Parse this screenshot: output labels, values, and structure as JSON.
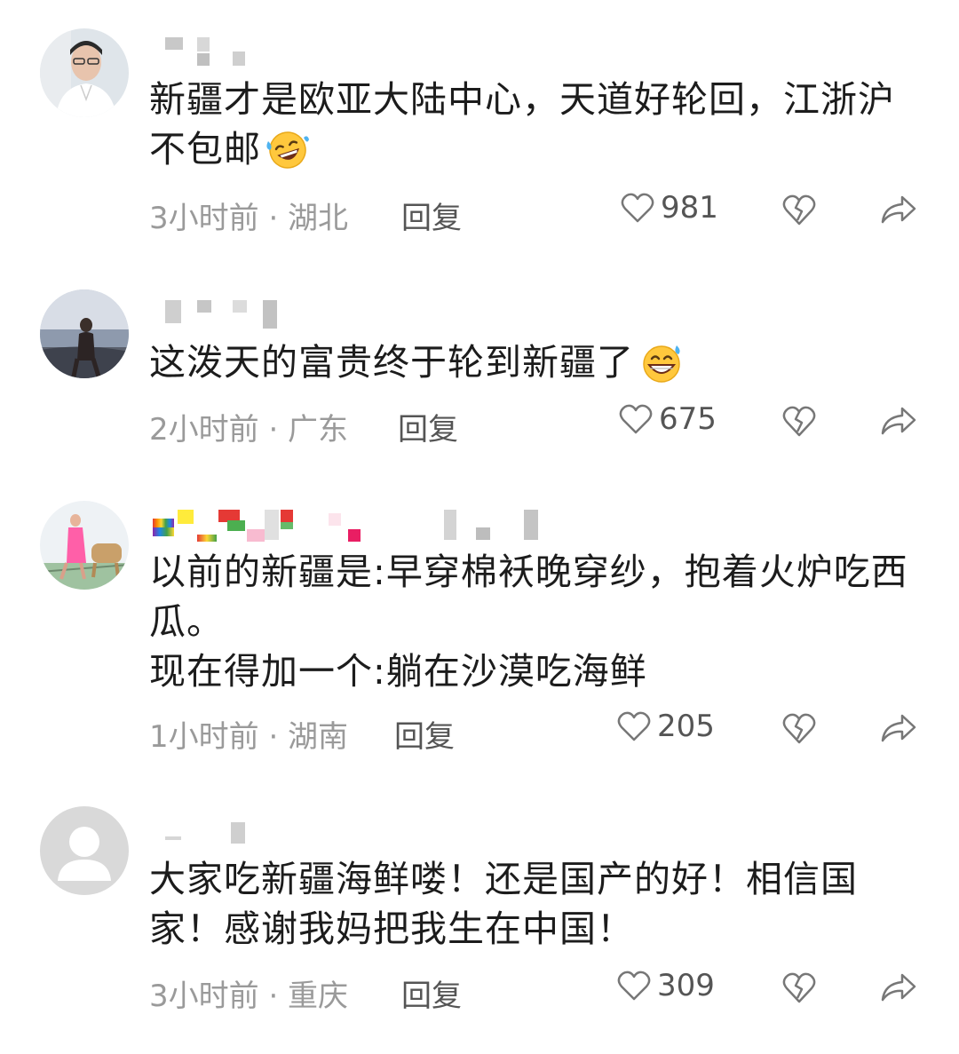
{
  "comments": [
    {
      "text_lines": [
        "新疆才是欧亚大陆中心，天道好轮回，江浙沪",
        "不包邮"
      ],
      "emoji": "laughing-crying-emoji",
      "time_location": "3小时前 · 湖北",
      "reply_label": "回复",
      "likes": "981"
    },
    {
      "text_lines": [
        "这泼天的富贵终于轮到新疆了"
      ],
      "emoji": "grin-sweat-emoji",
      "time_location": "2小时前 · 广东",
      "reply_label": "回复",
      "likes": "675"
    },
    {
      "text_lines": [
        "以前的新疆是:早穿棉袄晚穿纱，抱着火炉吃西",
        "瓜。",
        "现在得加一个:躺在沙漠吃海鲜"
      ],
      "time_location": "1小时前 · 湖南",
      "reply_label": "回复",
      "likes": "205"
    },
    {
      "text_lines": [
        "大家吃新疆海鲜喽！还是国产的好！相信国",
        "家！感谢我妈把我生在中国！"
      ],
      "time_location": "3小时前 · 重庆",
      "reply_label": "回复",
      "likes": "309"
    }
  ],
  "icons": {
    "like": "heart-outline-icon",
    "dislike": "broken-heart-icon",
    "share": "share-arrow-icon"
  },
  "colors": {
    "text": "#1c1c1c",
    "meta": "#9a9a9a",
    "icon": "#555555"
  }
}
